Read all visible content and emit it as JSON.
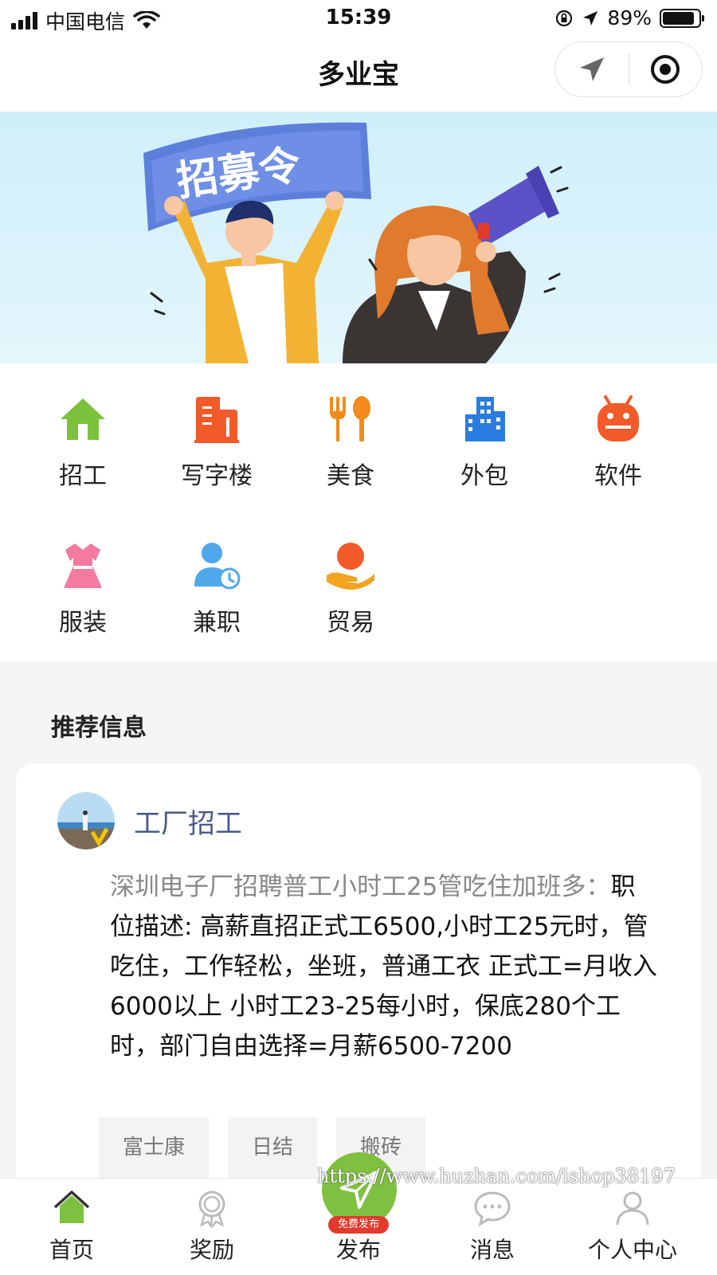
{
  "status_bar": {
    "carrier": "中国电信",
    "time": "15:39",
    "battery": "89%",
    "battery_level": 0.89
  },
  "header": {
    "title": "多业宝"
  },
  "banner": {
    "sign_text": "招募令"
  },
  "categories": [
    {
      "label": "招工",
      "icon": "house-icon",
      "color": "#7cc13c"
    },
    {
      "label": "写字楼",
      "icon": "office-building-icon",
      "color": "#f25a2a"
    },
    {
      "label": "美食",
      "icon": "fork-spoon-icon",
      "color": "#f28a1e"
    },
    {
      "label": "外包",
      "icon": "city-building-icon",
      "color": "#2b7ce0"
    },
    {
      "label": "软件",
      "icon": "android-robot-icon",
      "color": "#f25a2a"
    },
    {
      "label": "服装",
      "icon": "dress-icon",
      "color": "#f47aa0"
    },
    {
      "label": "兼职",
      "icon": "user-clock-icon",
      "color": "#4ea8ea"
    },
    {
      "label": "贸易",
      "icon": "hand-coin-icon",
      "color": "#f28a1e"
    }
  ],
  "recommend": {
    "title": "推荐信息",
    "card": {
      "category": "工厂招工",
      "desc_first": "深圳电子厂招聘普工小时工25管吃住加班多：",
      "desc_body": "职位描述: 高薪直招正式工6500,小时工25元时，管吃住，工作轻松，坐班，普通工衣 正式工=月收入6000以上 小时工23-25每小时，保底280个工时，部门自由选择=月薪6500-7200",
      "tags": [
        "富士康",
        "日结",
        "搬砖"
      ]
    }
  },
  "tab_bar": {
    "items": [
      "首页",
      "奖励",
      "发布",
      "消息",
      "个人中心"
    ],
    "publish_badge": "免费发布",
    "active_color": "#7ec03f"
  },
  "watermark": "https://www.huzhan.com/ishop38197"
}
